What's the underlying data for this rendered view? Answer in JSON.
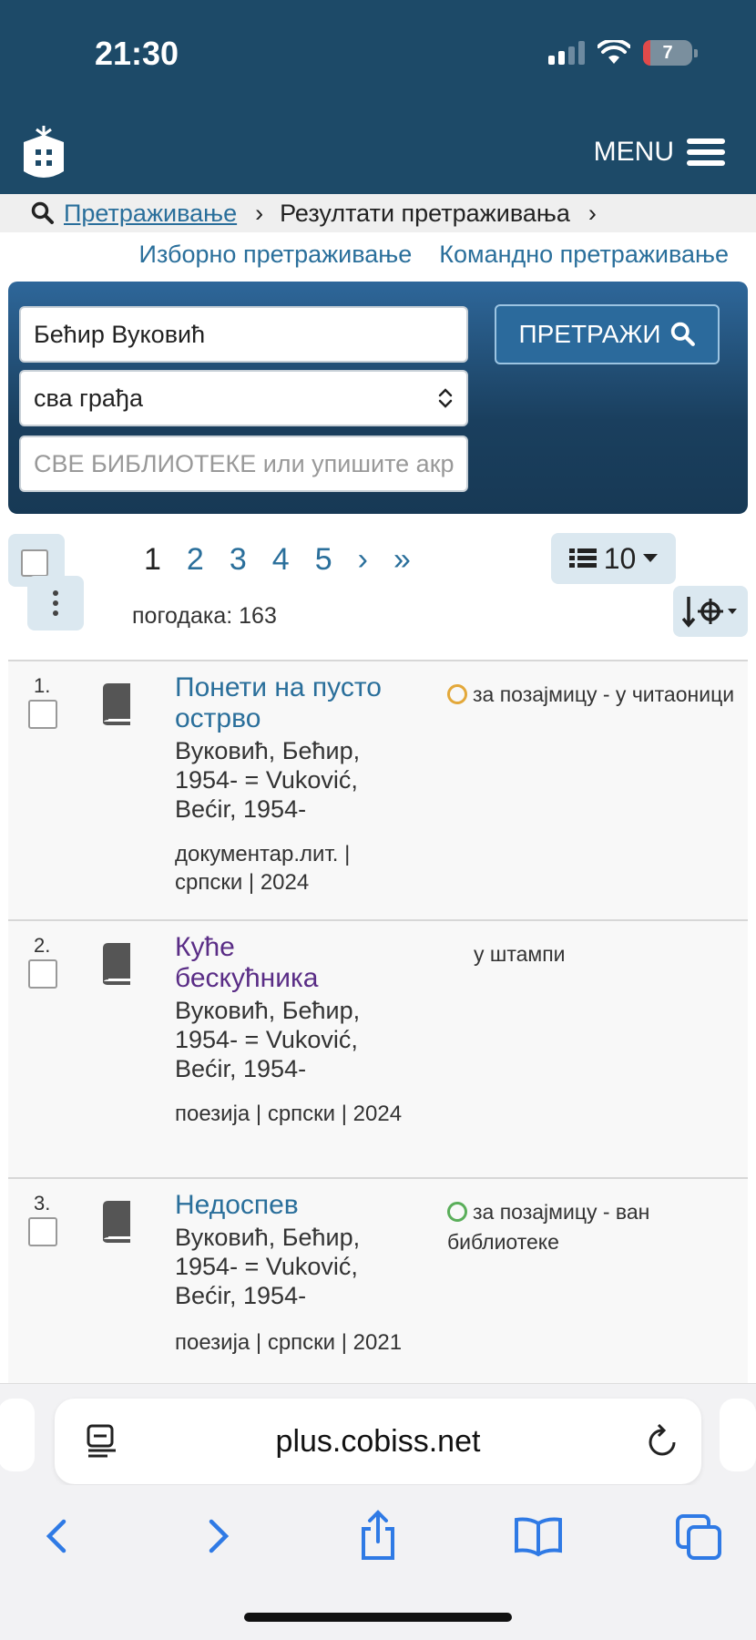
{
  "status_bar": {
    "time": "21:30",
    "battery": "7"
  },
  "header": {
    "menu_label": "MENU"
  },
  "breadcrumb": {
    "search_link": "Претраживање",
    "current": "Резултати претраживања",
    "sep": "›"
  },
  "links": {
    "selective": "Изборно претраживање",
    "command": "Командно претраживање"
  },
  "search": {
    "query": "Бећир Вуковић",
    "material": "сва грађа",
    "library_placeholder": "СВЕ БИБЛИОТЕКЕ или упишите акр",
    "button": "ПРЕТРАЖИ"
  },
  "pager": {
    "pages": [
      "1",
      "2",
      "3",
      "4",
      "5"
    ],
    "current": "1",
    "next": "›",
    "last": "»",
    "per_page": "10"
  },
  "hits": "погодака: 163",
  "results": [
    {
      "num": "1.",
      "title": "Понети на пусто острво",
      "author": "Вуковић, Бећир, 1954- = Vuković, Bećir, 1954-",
      "meta": "документар.лит. | српски | 2024",
      "availability": "за позајмицу - у читаоници",
      "status_color": "#e3a83a"
    },
    {
      "num": "2.",
      "title": "Куће бескућника",
      "author": "Вуковић, Бећир, 1954- = Vuković, Bećir, 1954-",
      "meta": "поезија | српски | 2024",
      "availability": "у штампи"
    },
    {
      "num": "3.",
      "title": "Недоспев",
      "author": "Вуковић, Бећир, 1954- = Vuković, Bećir, 1954-",
      "meta": "поезија | српски | 2021",
      "availability": "за позајмицу - ван библиотеке",
      "status_color": "#5aae5a"
    }
  ],
  "browser": {
    "url": "plus.cobiss.net"
  },
  "icons": [
    "logo-icon",
    "hamburger-icon",
    "search-icon",
    "chevron-updown-icon",
    "kebab-icon",
    "list-icon",
    "caret-down-icon",
    "sort-icon",
    "book-icon",
    "reader-icon",
    "reload-icon",
    "back-icon",
    "forward-icon",
    "share-icon",
    "bookmarks-icon",
    "tabs-icon"
  ]
}
